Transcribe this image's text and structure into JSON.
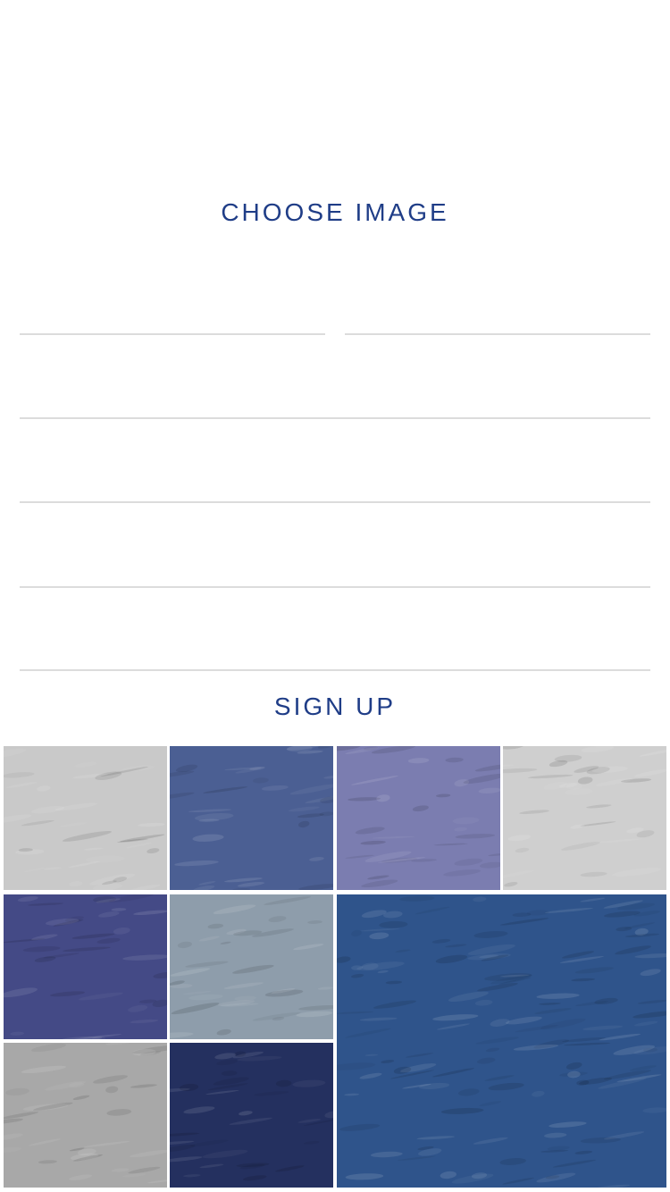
{
  "form": {
    "choose_image_label": "CHOOSE IMAGE",
    "first_name_value": "",
    "last_name_value": "",
    "field3_value": "",
    "field4_value": "",
    "field5_value": "",
    "field6_value": "",
    "signup_label": "SIGN UP"
  },
  "colors": {
    "accent": "#1f3d87",
    "divider": "#dcdcdc"
  },
  "gallery": {
    "tiles": [
      {
        "color": "#c9c9c9"
      },
      {
        "color": "#4b5f93"
      },
      {
        "color": "#7b7db0"
      },
      {
        "color": "#cfcfcf"
      },
      {
        "color": "#444a86"
      },
      {
        "color": "#8e9dab"
      },
      {
        "color": "#2f548b"
      },
      {
        "color": "#a8a8a8"
      },
      {
        "color": "#24305f"
      }
    ]
  }
}
